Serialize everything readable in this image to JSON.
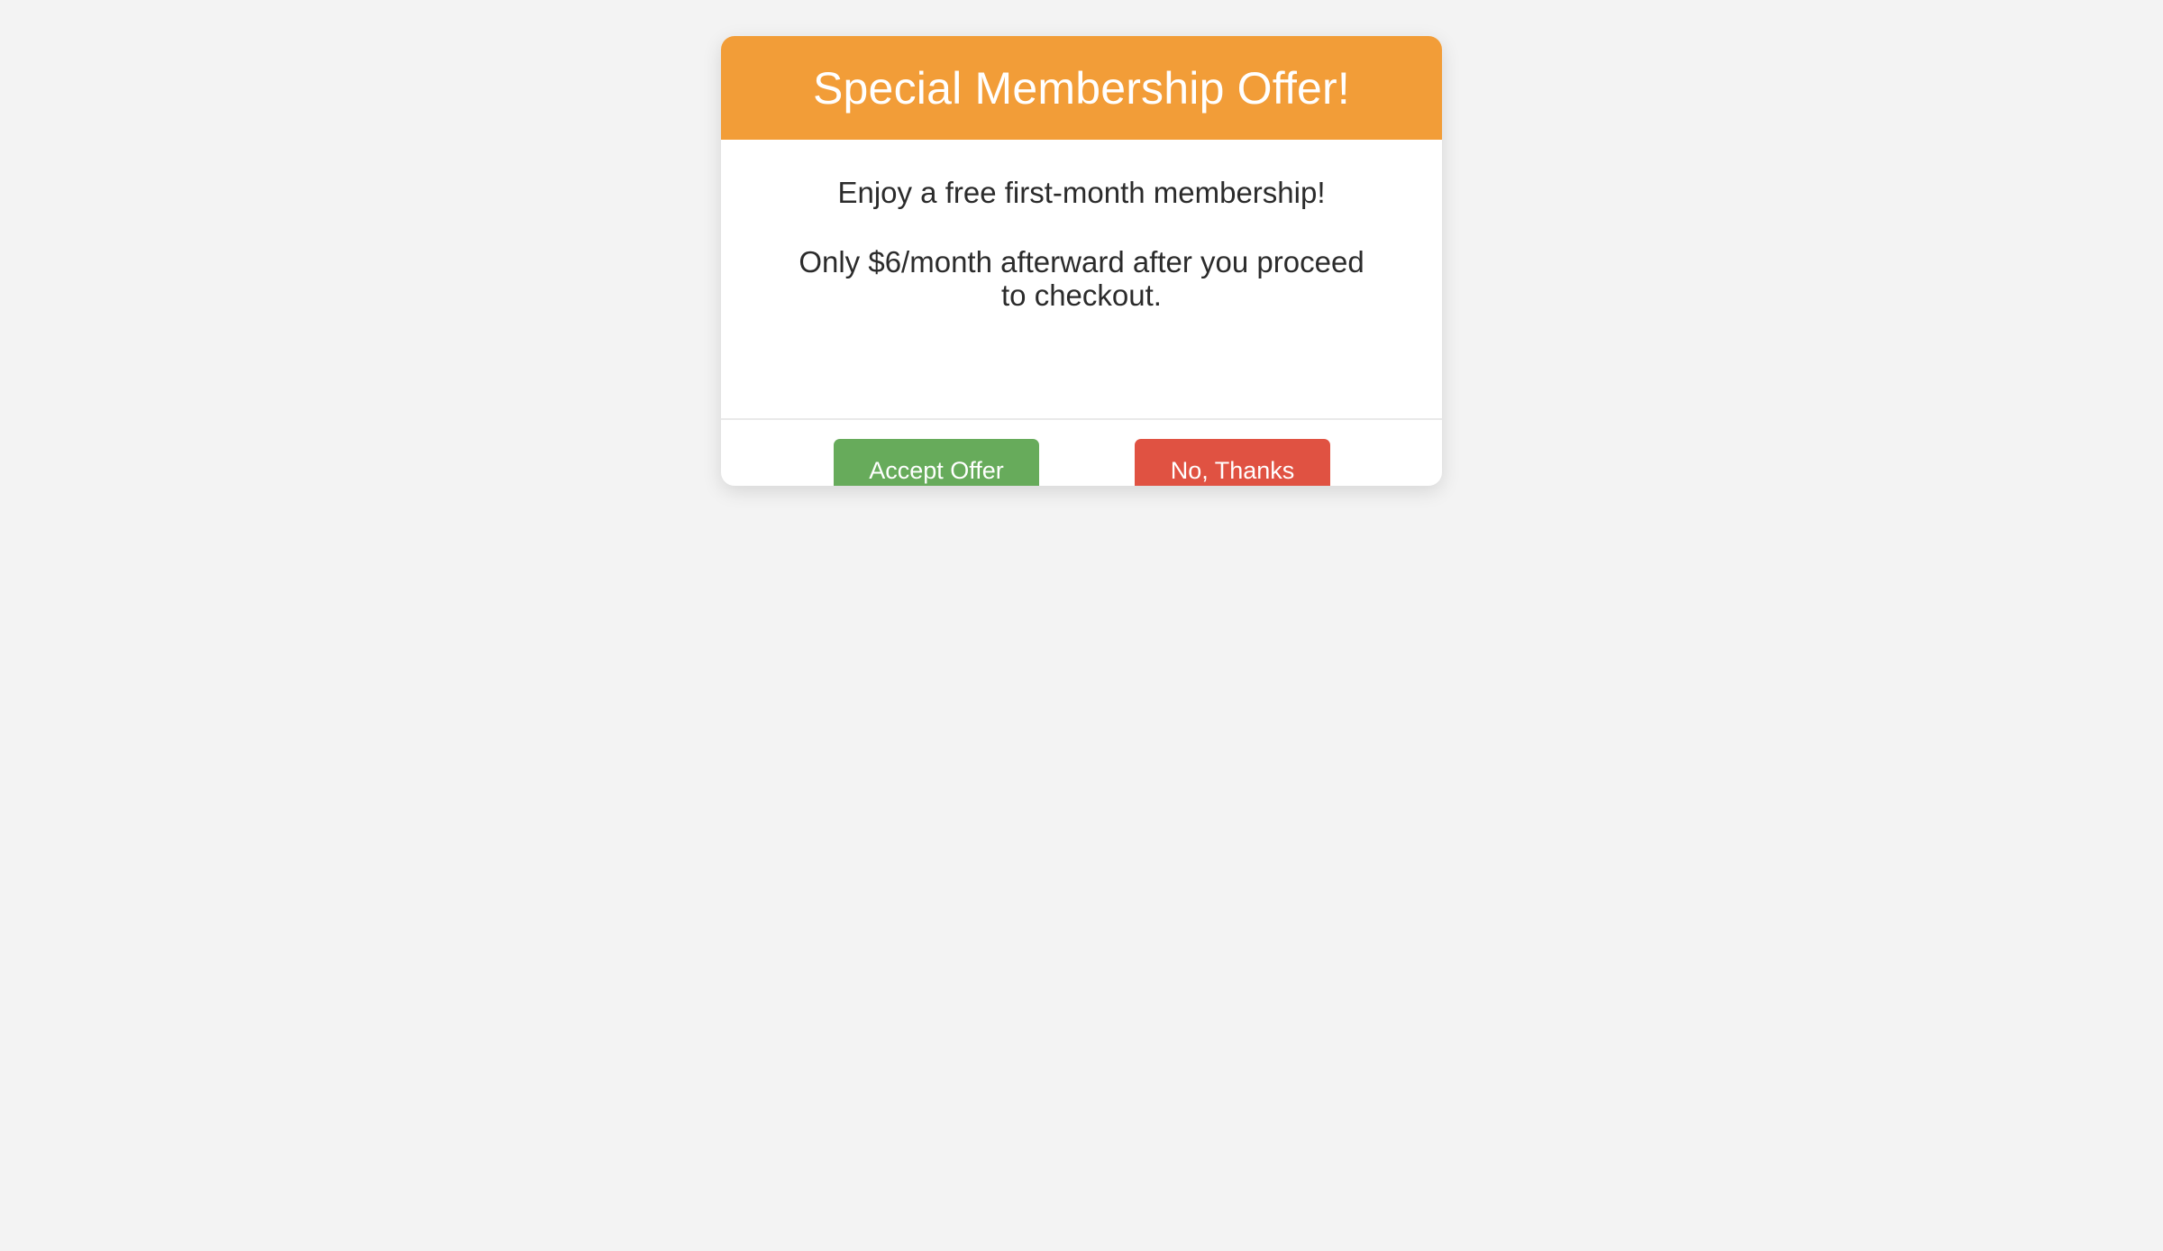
{
  "modal": {
    "title": "Special Membership Offer!",
    "body": {
      "line1": "Enjoy a free first-month membership!",
      "line2": "Only $6/month afterward after you proceed to checkout."
    },
    "buttons": {
      "accept_label": "Accept Offer",
      "decline_label": "No, Thanks"
    }
  },
  "colors": {
    "page_background": "#f3f3f3",
    "header_background": "#f29d38",
    "accept_button": "#67ab5b",
    "decline_button": "#e05242",
    "body_text": "#2b2b2b"
  }
}
